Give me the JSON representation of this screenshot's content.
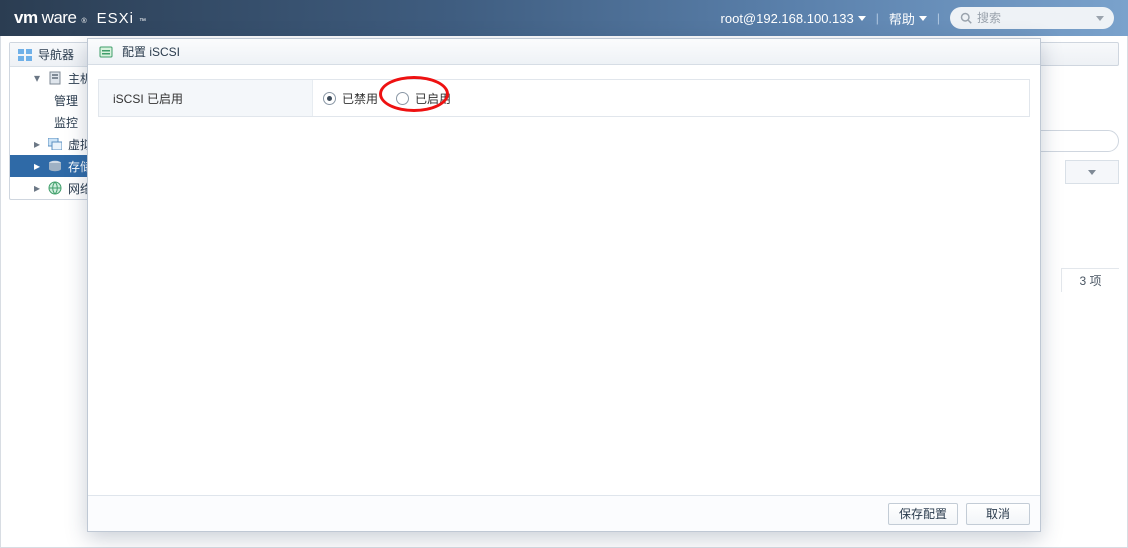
{
  "banner": {
    "brand_vm": "vm",
    "brand_ware": "ware",
    "sup": "®",
    "esxi": "ESXi",
    "tm": "™",
    "user": "root@192.168.100.133",
    "help": "帮助",
    "search_placeholder": "搜索"
  },
  "nav": {
    "title": "导航器",
    "items": [
      {
        "label": "主机",
        "kind": "host"
      },
      {
        "label": "管理",
        "kind": "sub"
      },
      {
        "label": "监控",
        "kind": "sub"
      },
      {
        "label": "虚拟机",
        "kind": "vm"
      },
      {
        "label": "存储",
        "kind": "storage",
        "selected": true
      },
      {
        "label": "网络",
        "kind": "net"
      }
    ]
  },
  "right_pane": {
    "count_label": "3 项"
  },
  "dialog": {
    "title": "配置 iSCSI",
    "row_label": "iSCSI 已启用",
    "radio_disabled": "已禁用",
    "radio_enabled": "已启用",
    "selected_value": "disabled",
    "save": "保存配置",
    "cancel": "取消"
  }
}
